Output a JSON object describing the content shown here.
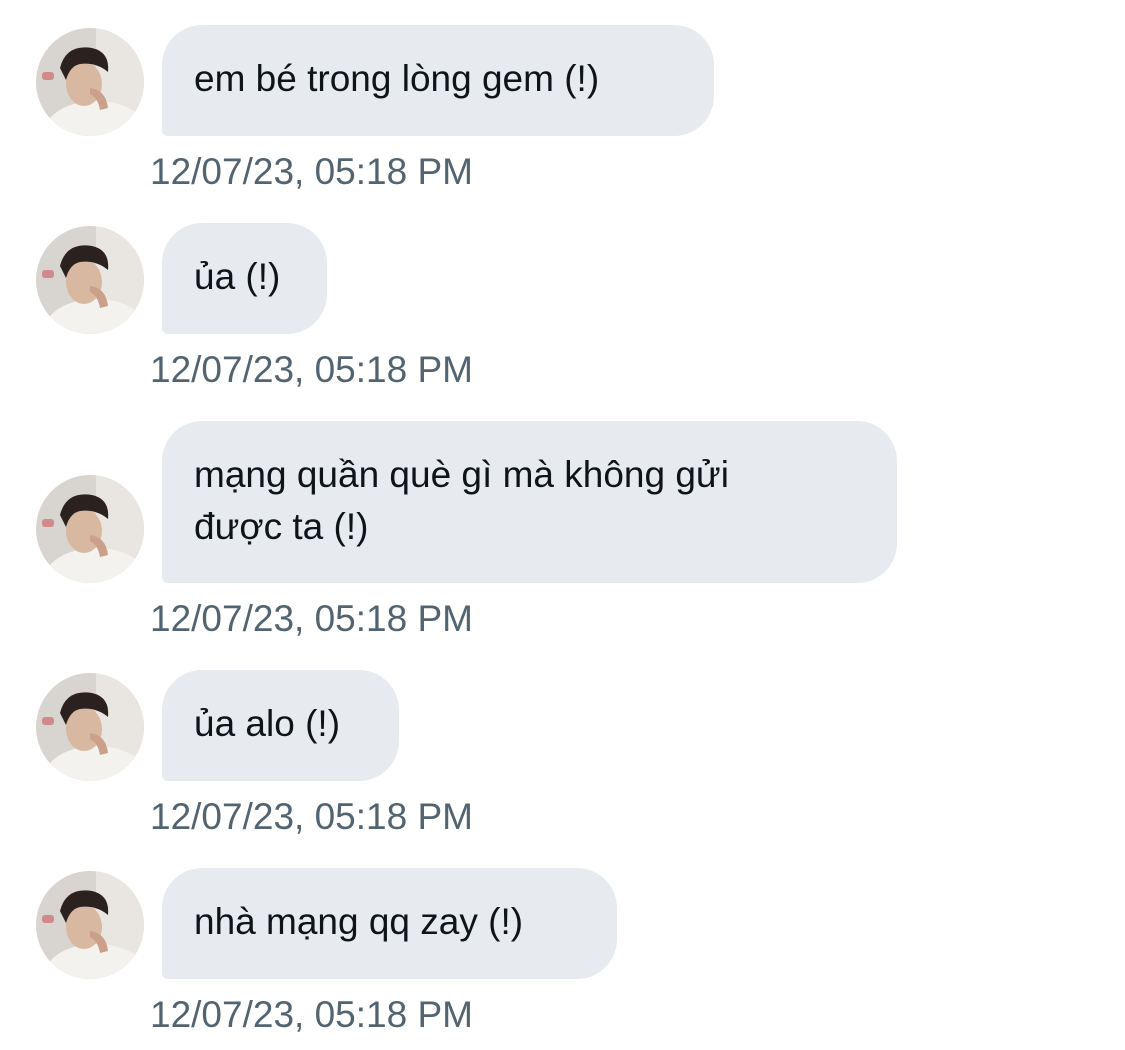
{
  "messages": [
    {
      "text": "em bé trong lòng gem (!)",
      "time": "12/07/23, 05:18 PM"
    },
    {
      "text": "ủa (!)",
      "time": "12/07/23, 05:18 PM"
    },
    {
      "text": "mạng quần què gì mà không gửi\nđược ta (!)",
      "time": "12/07/23, 05:18 PM"
    },
    {
      "text": "ủa alo (!)",
      "time": "12/07/23, 05:18 PM"
    },
    {
      "text": "nhà mạng qq zay (!)",
      "time": "12/07/23, 05:18 PM"
    }
  ],
  "icons": {
    "avatar": "user-avatar-icon"
  },
  "colors": {
    "bubble": "#e7eaef",
    "text": "#0f1419",
    "timestamp": "#536471"
  }
}
